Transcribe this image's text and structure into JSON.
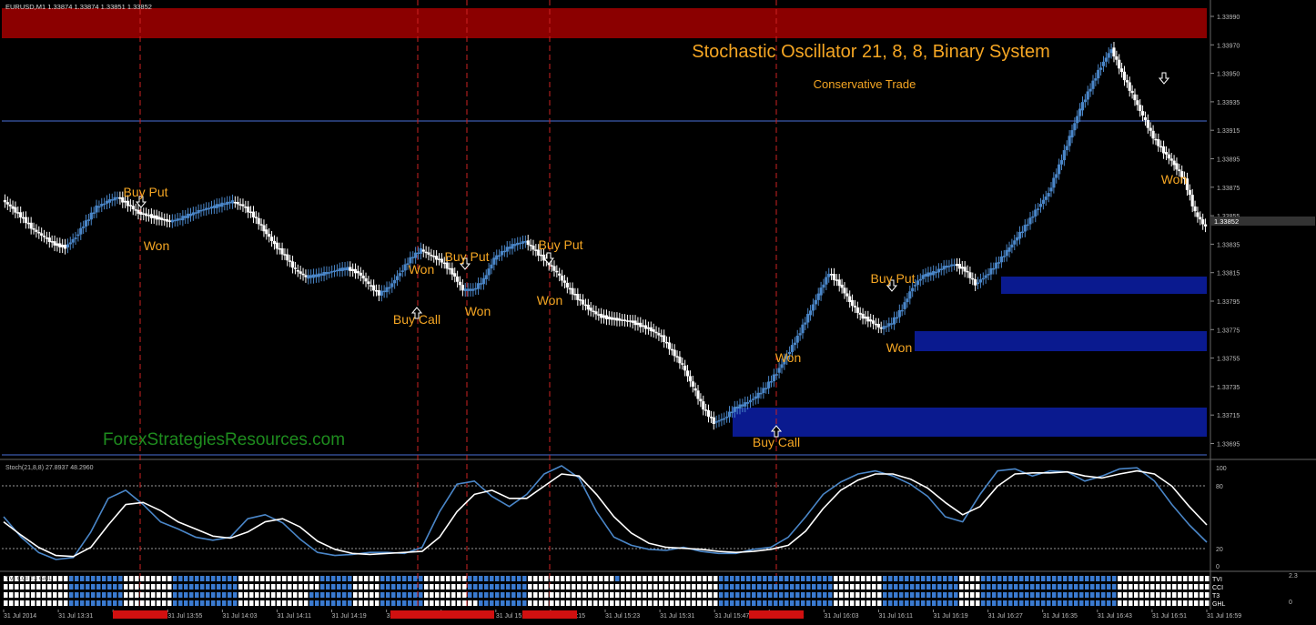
{
  "chart_header": {
    "symbol_text": "EURUSD,M1  1.33874 1.33874 1.33851 1.33852"
  },
  "title": "Stochastic Oscillator 21, 8, 8, Binary System",
  "subtitle": "Conservative Trade",
  "watermark": "ForexStrategiesResources.com",
  "current_price_label": "1.33852",
  "price_axis": {
    "ticks": [
      "1.33990",
      "1.33970",
      "1.33950",
      "1.33935",
      "1.33915",
      "1.33895",
      "1.33875",
      "1.33855",
      "1.33835",
      "1.33815",
      "1.33795",
      "1.33775",
      "1.33755",
      "1.33735",
      "1.33715",
      "1.33695"
    ]
  },
  "time_axis": {
    "labels": [
      "31 Jul 2014",
      "31 Jul 13:31",
      "31 Jul 1",
      "31 Jul 13:55",
      "31 Jul 14:03",
      "31 Jul 14:11",
      "31 Jul 14:19",
      "31 Jul 14:2",
      "31 Jul 14:5",
      "31 Jul 15:07",
      "31 Jul 15:15",
      "31 Jul 15:23",
      "31 Jul 15:31",
      "31 Jul 15:47",
      "31 Jul 15:55",
      "31 Jul 16:03",
      "31 Jul 16:11",
      "31 Jul 16:19",
      "31 Jul 16:27",
      "31 Jul 16:35",
      "31 Jul 16:43",
      "31 Jul 16:51",
      "31 Jul 16:59"
    ]
  },
  "signals": [
    {
      "text": "Buy Put"
    },
    {
      "text": "Won"
    },
    {
      "text": "Buy Call"
    },
    {
      "text": "Won"
    },
    {
      "text": "Buy Put"
    },
    {
      "text": "Won"
    },
    {
      "text": "Buy Put"
    },
    {
      "text": "Won"
    },
    {
      "text": "Won"
    },
    {
      "text": "Buy Call"
    },
    {
      "text": "Buy Put"
    },
    {
      "text": "Won"
    },
    {
      "text": "Won"
    }
  ],
  "stoch_panel": {
    "header": "Stoch(21,8,8) 27.8937 48.2960",
    "ticks": [
      "100",
      "80",
      "20",
      "0"
    ]
  },
  "bottom_panel": {
    "header": "TVI CCI T3 GHL",
    "ticks": [
      "2.3",
      "0"
    ],
    "row_labels": [
      "TVI",
      "CCI",
      "T3",
      "GHL"
    ]
  },
  "colors": {
    "background": "#000000",
    "bull_candle": "#4a86c8",
    "bear_candle": "#ffffff",
    "signal_text": "#f5a623",
    "resistance_zone": "#8b0000",
    "support_zone": "#0a1a8f",
    "vline": "#cc2222",
    "watermark": "#1e8c1e"
  },
  "chart_data": {
    "type": "candlestick",
    "price_series": [
      1.33871,
      1.33865,
      1.33858,
      1.3385,
      1.33845,
      1.3384,
      1.33838,
      1.33845,
      1.33856,
      1.33866,
      1.3387,
      1.33873,
      1.33868,
      1.33862,
      1.3386,
      1.33858,
      1.33856,
      1.33858,
      1.33861,
      1.33864,
      1.33866,
      1.33868,
      1.3387,
      1.33867,
      1.3386,
      1.3385,
      1.3384,
      1.33832,
      1.33822,
      1.33817,
      1.33818,
      1.3382,
      1.33822,
      1.33823,
      1.3382,
      1.33812,
      1.33805,
      1.3381,
      1.3382,
      1.3383,
      1.33836,
      1.33832,
      1.33828,
      1.3382,
      1.33808,
      1.33808,
      1.33815,
      1.3383,
      1.33836,
      1.3384,
      1.33842,
      1.33835,
      1.33828,
      1.3382,
      1.3381,
      1.33802,
      1.33795,
      1.3379,
      1.33788,
      1.33787,
      1.33786,
      1.33783,
      1.3378,
      1.33775,
      1.33765,
      1.33755,
      1.3374,
      1.33725,
      1.33715,
      1.33718,
      1.33725,
      1.33728,
      1.33733,
      1.3374,
      1.3375,
      1.33762,
      1.33775,
      1.3379,
      1.33805,
      1.3382,
      1.33812,
      1.338,
      1.3379,
      1.33786,
      1.33781,
      1.33785,
      1.33795,
      1.3381,
      1.33818,
      1.3382,
      1.33824,
      1.33826,
      1.33822,
      1.33812,
      1.33818,
      1.33826,
      1.33835,
      1.33845,
      1.33855,
      1.33866,
      1.33876,
      1.33895,
      1.33915,
      1.33935,
      1.3395,
      1.33965,
      1.33977,
      1.3396,
      1.33945,
      1.3393,
      1.33915,
      1.33905,
      1.33896,
      1.33885,
      1.33862,
      1.33852
    ],
    "stoch_main": [
      50,
      30,
      15,
      8,
      10,
      35,
      68,
      76,
      62,
      45,
      38,
      30,
      27,
      30,
      48,
      52,
      44,
      28,
      15,
      12,
      13,
      15,
      15,
      14,
      20,
      55,
      82,
      85,
      70,
      60,
      72,
      92,
      100,
      88,
      55,
      30,
      22,
      18,
      17,
      20,
      16,
      14,
      14,
      18,
      20,
      30,
      50,
      72,
      84,
      92,
      95,
      90,
      82,
      70,
      50,
      45,
      72,
      95,
      97,
      90,
      95,
      94,
      85,
      90,
      97,
      98,
      85,
      62,
      42,
      25
    ],
    "stoch_signal": [
      45,
      32,
      20,
      12,
      11,
      20,
      42,
      62,
      64,
      56,
      45,
      38,
      31,
      29,
      35,
      45,
      48,
      40,
      26,
      18,
      14,
      13,
      14,
      15,
      16,
      30,
      55,
      72,
      76,
      68,
      68,
      80,
      92,
      90,
      72,
      50,
      34,
      24,
      20,
      19,
      18,
      16,
      15,
      16,
      18,
      22,
      36,
      58,
      76,
      86,
      92,
      92,
      87,
      78,
      64,
      52,
      60,
      80,
      92,
      93,
      93,
      94,
      90,
      88,
      92,
      95,
      92,
      80,
      60,
      42
    ],
    "stoch_ylim": [
      0,
      100
    ],
    "stoch_levels": [
      20,
      80
    ]
  }
}
